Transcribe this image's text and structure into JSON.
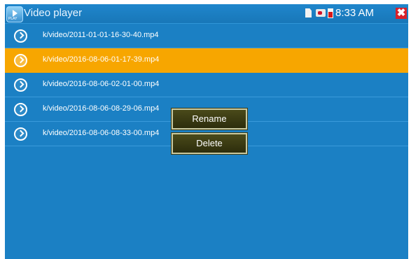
{
  "window": {
    "title": "Video player",
    "app_icon_label": "PLAY"
  },
  "status_bar": {
    "time": "8:33 AM",
    "icons": [
      "sd-card-icon",
      "usb-icon",
      "battery-icon",
      "close-icon"
    ],
    "close_glyph": "✖"
  },
  "files": [
    {
      "name": "k/video/2011-01-01-16-30-40.mp4",
      "selected": false
    },
    {
      "name": "k/video/2016-08-06-01-17-39.mp4",
      "selected": true
    },
    {
      "name": "k/video/2016-08-06-02-01-00.mp4",
      "selected": false
    },
    {
      "name": "k/video/2016-08-06-08-29-06.mp4",
      "selected": false
    },
    {
      "name": "k/video/2016-08-06-08-33-00.mp4",
      "selected": false
    }
  ],
  "context_menu": {
    "rename_label": "Rename",
    "delete_label": "Delete"
  },
  "colors": {
    "background": "#1b80c4",
    "selected_row": "#f7a600",
    "menu": "#3a3a14"
  }
}
